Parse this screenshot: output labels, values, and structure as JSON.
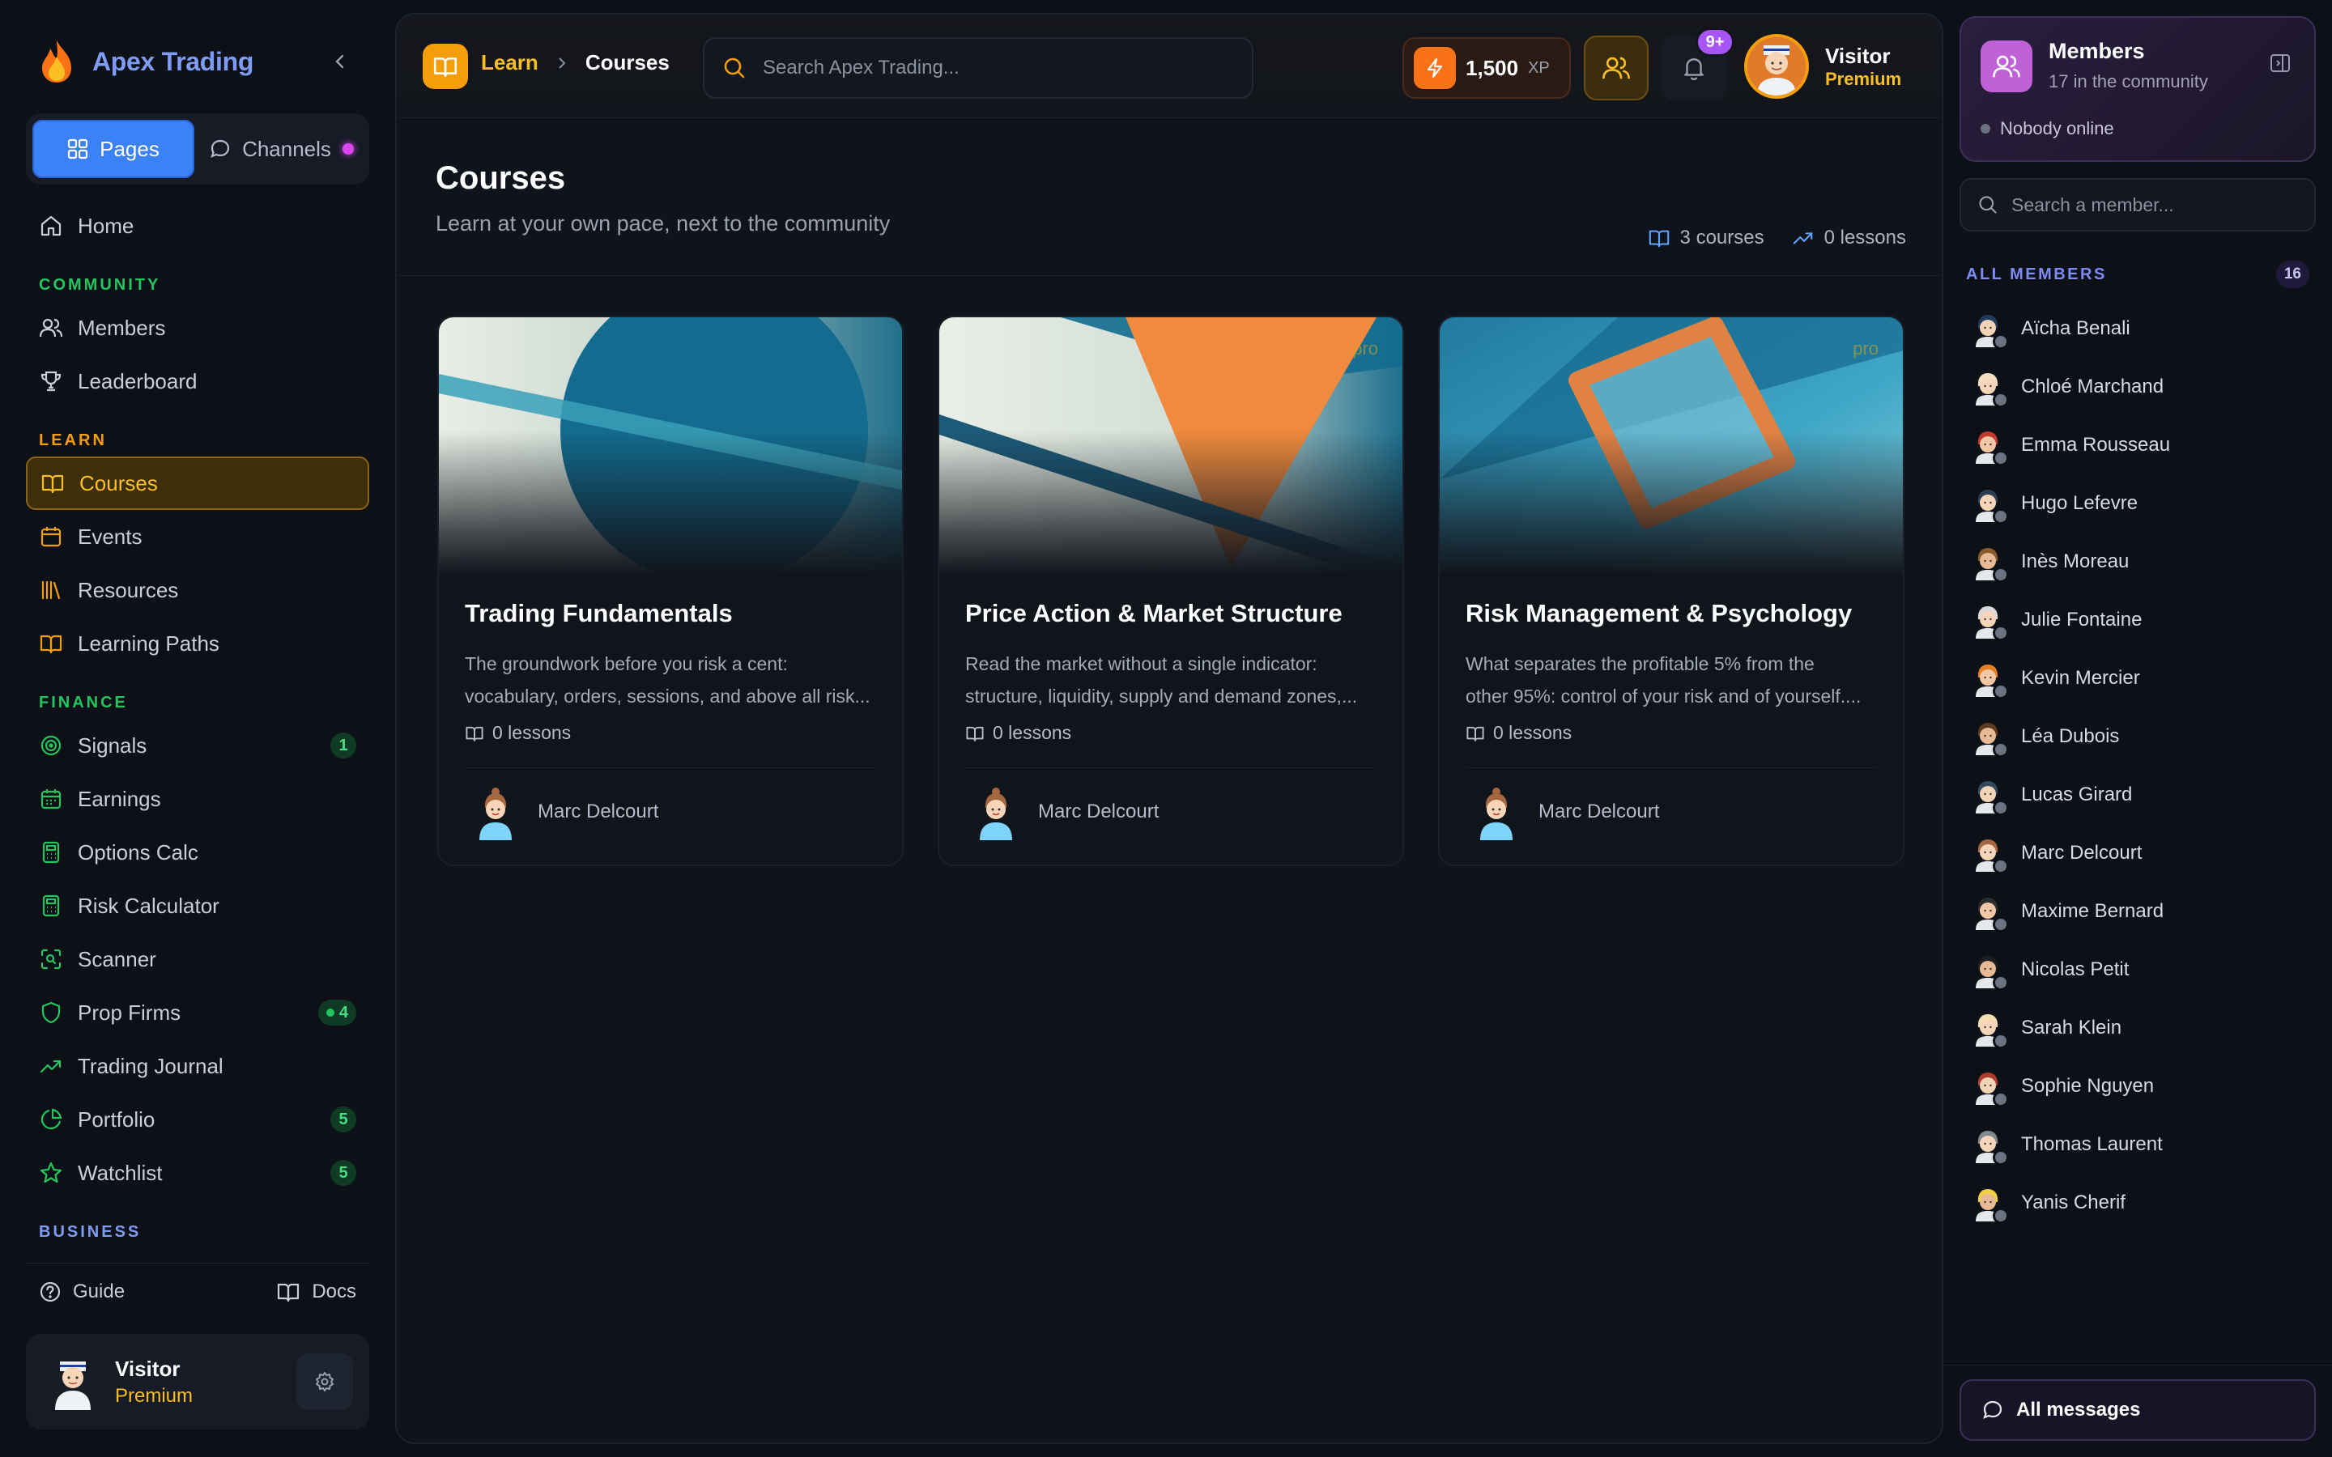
{
  "brand": {
    "name": "Apex Trading",
    "logo_icon": "flame-icon",
    "accent": "#7f9cf5"
  },
  "sidebar": {
    "mode_tabs": [
      {
        "label": "Pages",
        "active": true
      },
      {
        "label": "Channels",
        "active": false
      }
    ],
    "home": "Home",
    "sections": {
      "community": {
        "title": "COMMUNITY",
        "items": [
          "Members",
          "Leaderboard"
        ]
      },
      "learn": {
        "title": "LEARN",
        "items": [
          "Courses",
          "Events",
          "Resources",
          "Learning Paths"
        ]
      },
      "finance": {
        "title": "FINANCE",
        "items": [
          "Signals",
          "Earnings",
          "Options Calc",
          "Risk Calculator",
          "Scanner",
          "Prop Firms",
          "Trading Journal",
          "Portfolio",
          "Watchlist"
        ]
      },
      "business": {
        "title": "BUSINESS"
      }
    },
    "badges": {
      "signals": "1",
      "prop_firms": "4",
      "portfolio": "5",
      "watchlist": "5"
    },
    "footer": {
      "guide": "Guide",
      "docs": "Docs"
    },
    "user": {
      "name": "Visitor",
      "tier": "Premium"
    }
  },
  "topbar": {
    "breadcrumb": {
      "parent": "Learn",
      "current": "Courses"
    },
    "search": {
      "placeholder": "Search Apex Trading..."
    },
    "xp": {
      "value": "1,500",
      "unit": "XP"
    },
    "notifications": {
      "badge": "9+"
    },
    "profile": {
      "name": "Visitor",
      "tier": "Premium"
    }
  },
  "page": {
    "title": "Courses",
    "subtitle": "Learn at your own pace, next to the community",
    "stats": {
      "courses": "3 courses",
      "lessons": "0 lessons"
    }
  },
  "courses": [
    {
      "title": "Trading Fundamentals",
      "desc_1": "The groundwork before you risk a cent:",
      "desc_2": "vocabulary, orders, sessions, and above all risk...",
      "lessons": "0 lessons",
      "author": "Marc Delcourt",
      "pro_label": ""
    },
    {
      "title": "Price Action & Market Structure",
      "desc_1": "Read the market without a single indicator:",
      "desc_2": "structure, liquidity, supply and demand zones,...",
      "lessons": "0 lessons",
      "author": "Marc Delcourt",
      "pro_label": "pro"
    },
    {
      "title": "Risk Management & Psychology",
      "desc_1": "What separates the profitable 5% from the",
      "desc_2": "other 95%: control of your risk and of yourself....",
      "lessons": "0 lessons",
      "author": "Marc Delcourt",
      "pro_label": "pro"
    }
  ],
  "members_panel": {
    "title": "Members",
    "subtitle": "17 in the community",
    "online": "Nobody online",
    "search_placeholder": "Search a member...",
    "all_label": "ALL MEMBERS",
    "count": "16",
    "members": [
      "Aïcha Benali",
      "Chloé Marchand",
      "Emma Rousseau",
      "Hugo Lefevre",
      "Inès Moreau",
      "Julie Fontaine",
      "Kevin Mercier",
      "Léa Dubois",
      "Lucas Girard",
      "Marc Delcourt",
      "Maxime Bernard",
      "Nicolas Petit",
      "Sarah Klein",
      "Sophie Nguyen",
      "Thomas Laurent",
      "Yanis Cherif"
    ],
    "all_messages": "All messages"
  },
  "colors": {
    "learn_accent": "#f59e0b",
    "finance_accent": "#22c55e",
    "pages_active": "#3b82f6",
    "premium": "#fbbf24"
  }
}
